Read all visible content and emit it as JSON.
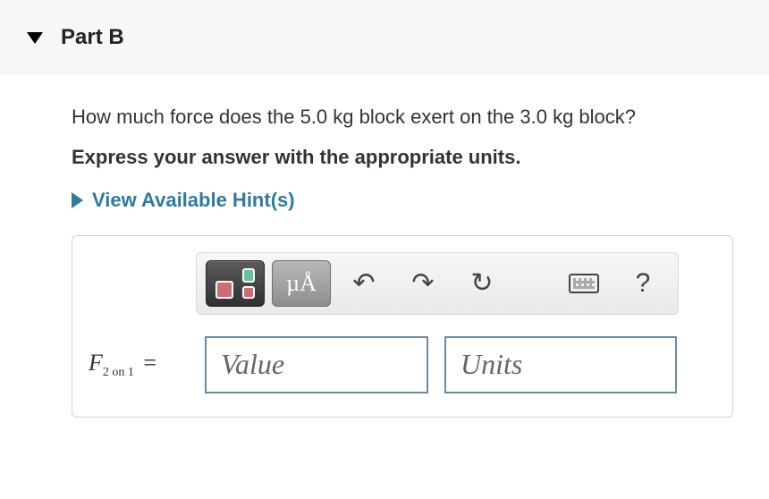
{
  "header": {
    "part_label": "Part B"
  },
  "question": "How much force does the 5.0 kg block exert on the 3.0 kg block?",
  "instruction": "Express your answer with the appropriate units.",
  "hints": {
    "label": "View Available Hint(s)"
  },
  "toolbar": {
    "mu_a": "µÅ",
    "help": "?"
  },
  "answer": {
    "variable_main": "F",
    "variable_sub": "2 on 1",
    "equals": " =",
    "value_placeholder": "Value",
    "units_placeholder": "Units"
  }
}
